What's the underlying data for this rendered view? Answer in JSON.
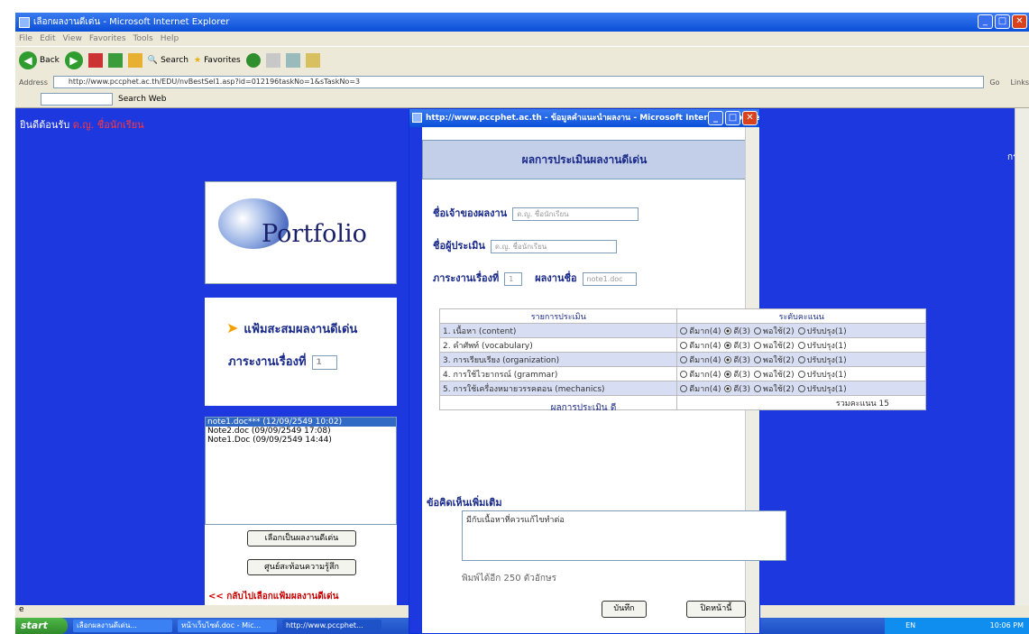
{
  "browser": {
    "title": "เลือกผลงานดีเด่น - Microsoft Internet Explorer",
    "menu": [
      "File",
      "Edit",
      "View",
      "Favorites",
      "Tools",
      "Help"
    ],
    "toolbar": {
      "back": "Back",
      "search": "Search",
      "favorites": "Favorites"
    },
    "address_label": "Address",
    "address": "http://www.pccphet.ac.th/EDU/nvBestSel1.asp?id=012196taskNo=1&sTaskNo=3",
    "go": "Go",
    "links": "Links",
    "search_web": "Search Web",
    "status": ""
  },
  "page": {
    "welcome_prefix": "ยินดีต้อนรับ",
    "welcome_user": "ด.ญ. ชื่อนักเรียน",
    "right_label": "กระบวน",
    "logo_text": "Portfolio",
    "heading": "แฟ้มสะสมผลงานดีเด่น",
    "task_label": "ภาระงานเรื่องที่",
    "task_value": "1",
    "files": [
      "note1.doc*** (12/09/2549 10:02)",
      "Note2.doc (09/09/2549 17:08)",
      "Note1.Doc (09/09/2549 14:44)"
    ],
    "btn_select": "เลือกเป็นผลงานดีเด่น",
    "btn_learning": "ศูนย์สะท้อนความรู้สึก",
    "back_link": "<< กลับไปเลือกแฟ้มผลงานดีเด่น"
  },
  "popup": {
    "title": "http://www.pccphet.ac.th - ข้อมูลคำแนะนำผลงาน - Microsoft Internet Explorer",
    "heading": "ผลการประเมินผลงานดีเด่น",
    "owner_label": "ชื่อเจ้าของผลงาน",
    "owner_value": "ด.ญ. ชื่อนักเรียน",
    "assessor_label": "ชื่อผู้ประเมิน",
    "assessor_value": "ด.ญ. ชื่อนักเรียน",
    "task_label": "ภาระงานเรื่องที่",
    "task_value": "1",
    "work_label": "ผลงานชื่อ",
    "work_value": "note1.doc",
    "table": {
      "col_items": "รายการประเมิน",
      "col_level": "ระดับคะแนน",
      "options": [
        "ดีมาก(4)",
        "ดี(3)",
        "พอใช้(2)",
        "ปรับปรุง(1)"
      ],
      "rows": [
        {
          "label": "1. เนื้อหา (content)",
          "selected": 1
        },
        {
          "label": "2. คำศัพท์ (vocabulary)",
          "selected": 1
        },
        {
          "label": "3. การเรียบเรียง (organization)",
          "selected": 1
        },
        {
          "label": "4. การใช้ไวยากรณ์ (grammar)",
          "selected": 1
        },
        {
          "label": "5. การใช้เครื่องหมายวรรคตอน (mechanics)",
          "selected": 1
        }
      ],
      "total": "รวมคะแนน 15"
    },
    "result": "ผลการประเมิน ดี",
    "comment_label": "ข้อคิดเห็นเพิ่มเติม",
    "comment_value": "มีกับเนื้อหาที่ควรแก้ไขทำต่อ",
    "remaining": "พิมพ์ได้อีก 250 ตัวอักษร",
    "btn_save": "บันทึก",
    "btn_close": "ปิดหน้านี้"
  },
  "taskbar": {
    "start": "start",
    "tasks": [
      "เลือกผลงานดีเด่น...",
      "หน้าเว็บไซต์.doc - Mic...",
      "http://www.pccphet..."
    ],
    "lang": "EN",
    "clock": "10:06 PM"
  }
}
